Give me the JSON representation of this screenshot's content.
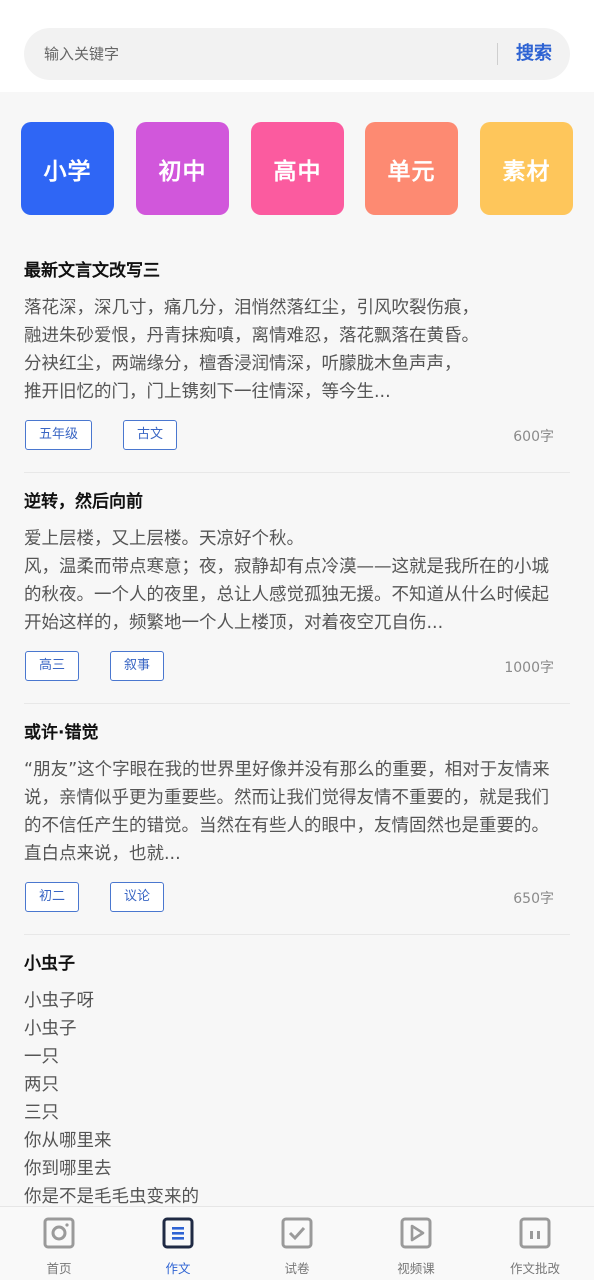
{
  "search": {
    "placeholder": "输入关键字",
    "button_label": "搜索"
  },
  "categories": [
    {
      "label": "小学",
      "color": "#2f66f5"
    },
    {
      "label": "初中",
      "color": "#d157db"
    },
    {
      "label": "高中",
      "color": "#fb5b9f"
    },
    {
      "label": "单元",
      "color": "#fd8a72"
    },
    {
      "label": "素材",
      "color": "#fec65b"
    }
  ],
  "articles": [
    {
      "title": "最新文言文改写三",
      "lines": [
        "落花深，深几寸，痛几分，泪悄然落红尘，引风吹裂伤痕，",
        "融进朱砂爱恨，丹青抹痴嗔，离情难忍，落花飘落在黄昏。",
        "分袂红尘，两端缘分，檀香浸润情深，听朦胧木鱼声声，",
        "推开旧忆的门，门上镌刻下一往情深，等今生..."
      ],
      "tags": [
        "五年级",
        "古文"
      ],
      "word_count": "600字"
    },
    {
      "title": "逆转，然后向前",
      "lines": [
        "爱上层楼，又上层楼。天凉好个秋。",
        "风，温柔而带点寒意；夜，寂静却有点冷漠——这就是我所在的小城",
        "的秋夜。一个人的夜里，总让人感觉孤独无援。不知道从什么时候起",
        "开始这样的，频繁地一个人上楼顶，对着夜空兀自伤..."
      ],
      "tags": [
        "高三",
        "叙事"
      ],
      "word_count": "1000字"
    },
    {
      "title": "或许·错觉",
      "lines": [
        "“朋友”这个字眼在我的世界里好像并没有那么的重要，相对于友情来",
        "说，亲情似乎更为重要些。然而让我们觉得友情不重要的，就是我们",
        "的不信任产生的错觉。当然在有些人的眼中，友情固然也是重要的。",
        "直白点来说，也就..."
      ],
      "tags": [
        "初二",
        "议论"
      ],
      "word_count": "650字"
    },
    {
      "title": "小虫子",
      "lines": [
        "小虫子呀",
        "小虫子",
        "一只",
        "两只",
        "三只",
        "你从哪里来",
        "你到哪里去",
        "你是不是毛毛虫变来的"
      ],
      "tags": [],
      "word_count": ""
    }
  ],
  "nav": [
    {
      "label": "首页",
      "icon": "camera-icon",
      "active": false
    },
    {
      "label": "作文",
      "icon": "essay-icon",
      "active": true
    },
    {
      "label": "试卷",
      "icon": "check-icon",
      "active": false
    },
    {
      "label": "视频课",
      "icon": "play-icon",
      "active": false
    },
    {
      "label": "作文批改",
      "icon": "correction-icon",
      "active": false
    }
  ],
  "colors": {
    "accent": "#2e63d3",
    "tag_border": "#4a77cf",
    "nav_icon": "#9a9a9a",
    "nav_icon_active": "#1f2a44"
  }
}
